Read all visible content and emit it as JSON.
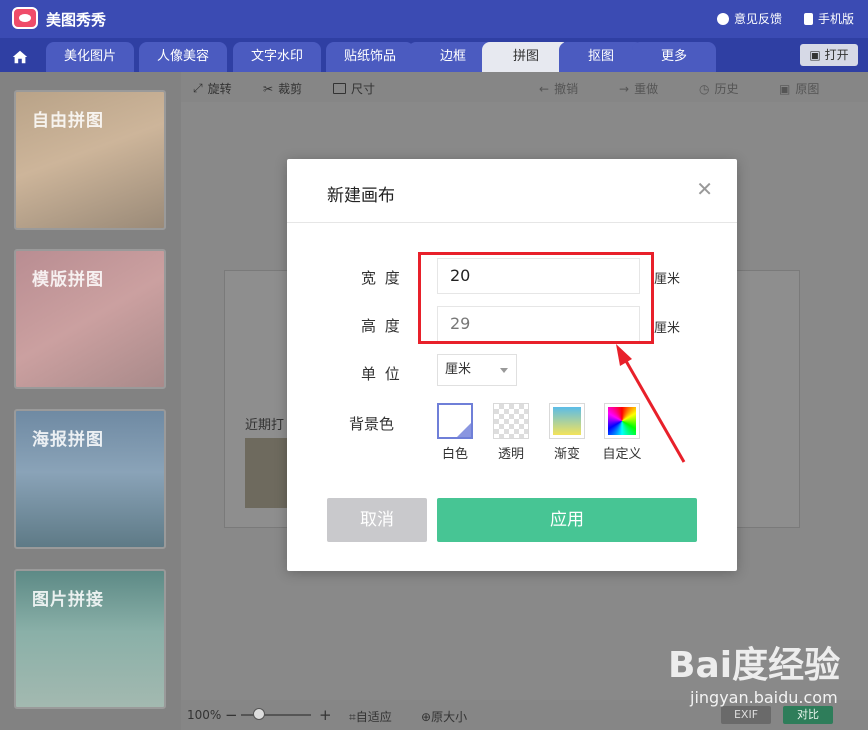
{
  "app": {
    "title": "美图秀秀"
  },
  "titlebar": {
    "feedback": "意见反馈",
    "mobile": "手机版"
  },
  "tabs": [
    {
      "label": "美化图片"
    },
    {
      "label": "人像美容"
    },
    {
      "label": "文字水印"
    },
    {
      "label": "贴纸饰品"
    },
    {
      "label": "边框"
    },
    {
      "label": "拼图",
      "active": true
    },
    {
      "label": "抠图"
    },
    {
      "label": "更多"
    }
  ],
  "open_label": "打开",
  "sidebar": {
    "cards": [
      {
        "label": "自由拼图"
      },
      {
        "label": "模版拼图"
      },
      {
        "label": "海报拼图"
      },
      {
        "label": "图片拼接"
      }
    ]
  },
  "toolbar": {
    "rotate": "旋转",
    "crop": "裁剪",
    "size": "尺寸",
    "undo": "撤销",
    "redo": "重做",
    "history": "历史",
    "original": "原图"
  },
  "canvas": {
    "recent": "近期打"
  },
  "bottom": {
    "zoom": "100%",
    "fit": "自适应",
    "actual": "原大小",
    "exif": "EXIF",
    "compare": "对比"
  },
  "dialog": {
    "title": "新建画布",
    "width_label": "宽 度",
    "width_value": "20",
    "height_label": "高 度",
    "height_value": "29",
    "unit_text": "厘米",
    "unit_label": "单 位",
    "unit_selected": "厘米",
    "bg_label": "背景色",
    "bg_options": [
      "白色",
      "透明",
      "渐变",
      "自定义"
    ],
    "cancel": "取消",
    "apply": "应用"
  },
  "watermark": {
    "logo": "Bai度经验",
    "url": "jingyan.baidu.com"
  },
  "colors": {
    "brand": "#3b4bb3",
    "apply": "#47c594",
    "annotation": "#e8202a"
  }
}
